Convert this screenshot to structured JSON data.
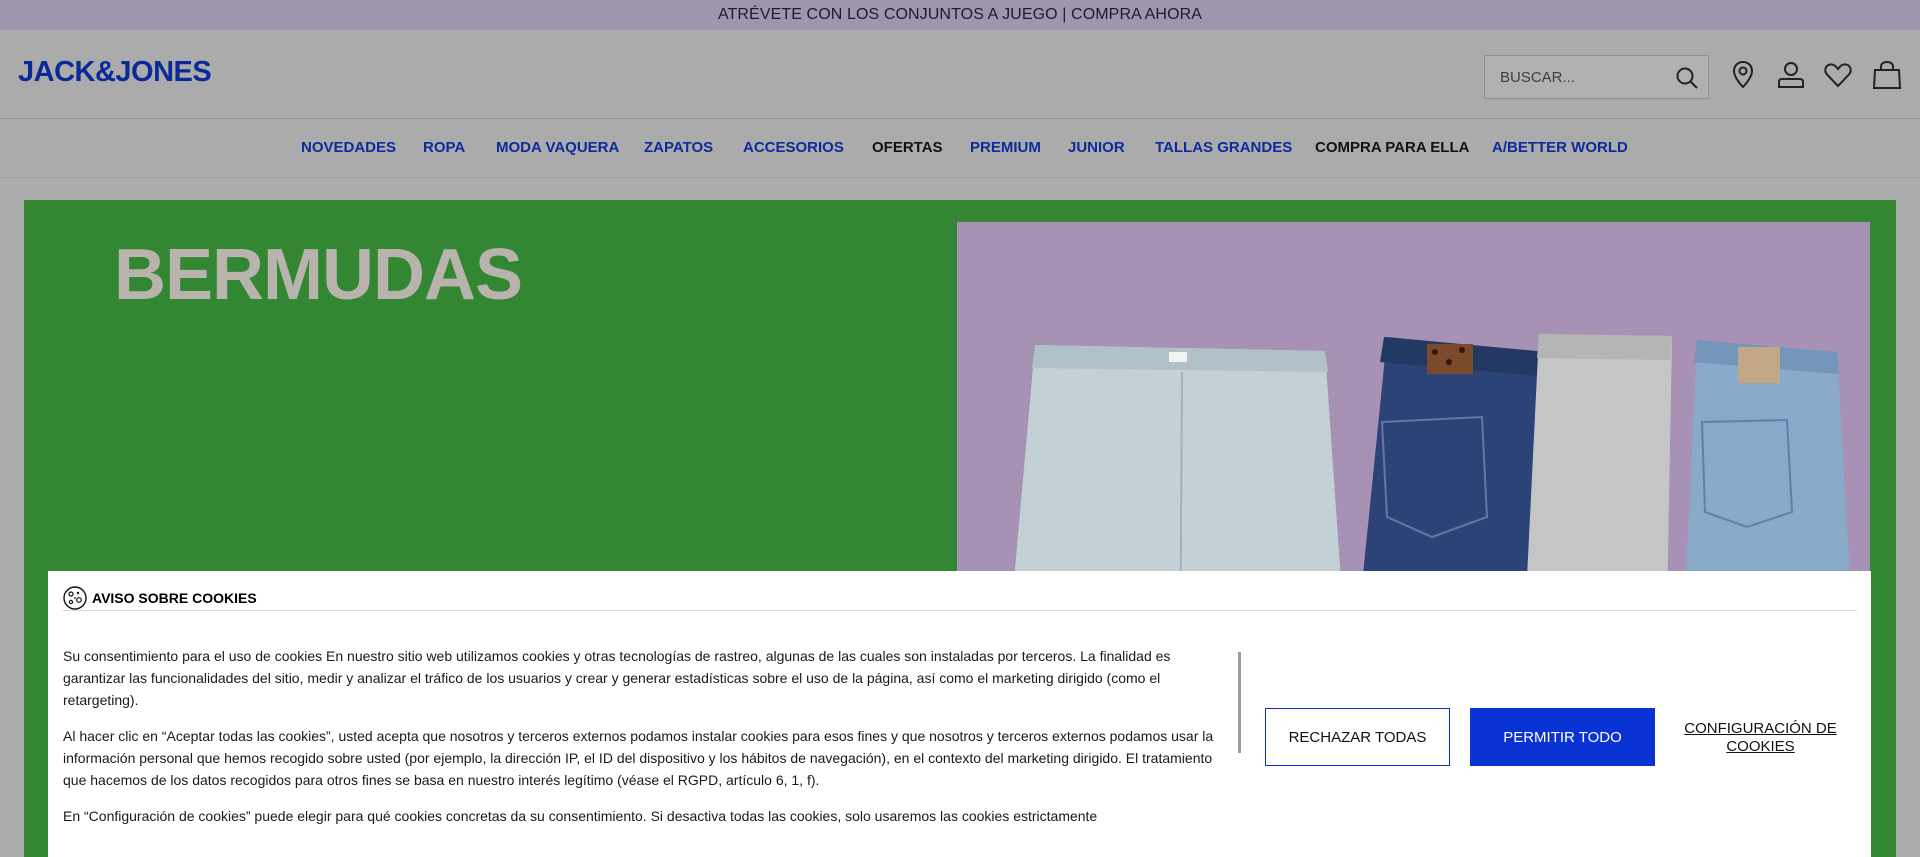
{
  "promo": {
    "text": "ATRÉVETE CON LOS CONJUNTOS A JUEGO | COMPRA AHORA"
  },
  "header": {
    "logo": "JACK&JONES",
    "search_placeholder": "BUSCAR...",
    "icons": [
      "store-locator-icon",
      "account-icon",
      "wishlist-icon",
      "bag-icon"
    ]
  },
  "nav": {
    "items": [
      {
        "label": "NOVEDADES",
        "style": "accent"
      },
      {
        "label": "ROPA",
        "style": "accent"
      },
      {
        "label": "MODA VAQUERA",
        "style": "accent"
      },
      {
        "label": "ZAPATOS",
        "style": "accent"
      },
      {
        "label": "ACCESORIOS",
        "style": "accent"
      },
      {
        "label": "OFERTAS",
        "style": "dark"
      },
      {
        "label": "PREMIUM",
        "style": "accent"
      },
      {
        "label": "JUNIOR",
        "style": "accent"
      },
      {
        "label": "TALLAS GRANDES",
        "style": "accent"
      },
      {
        "label": "COMPRA PARA ELLA",
        "style": "dark"
      },
      {
        "label": "A/BETTER WORLD",
        "style": "accent"
      }
    ]
  },
  "hero": {
    "title": "BERMUDAS"
  },
  "cookie": {
    "title": "AVISO SOBRE COOKIES",
    "paragraphs": [
      "Su consentimiento para el uso de cookies En nuestro sitio web utilizamos cookies y otras tecnologías de rastreo, algunas de las cuales son instaladas por terceros. La finalidad es garantizar las funcionalidades del sitio, medir y analizar el tráfico de los usuarios y crear y generar estadísticas sobre el uso de la página, así como el marketing dirigido (como el retargeting).",
      "Al hacer clic en “Aceptar todas las cookies”, usted acepta que nosotros y terceros externos podamos instalar cookies para esos fines y que nosotros y terceros externos podamos usar la información personal que hemos recogido sobre usted (por ejemplo, la dirección IP, el ID del dispositivo y los hábitos de navegación), en el contexto del marketing dirigido. El tratamiento que hacemos de los datos recogidos para otros fines se basa en nuestro interés legítimo (véase el RGPD, artículo 6, 1, f).",
      "En “Configuración de cookies” puede elegir para qué cookies concretas da su consentimiento. Si desactiva todas las cookies, solo usaremos las cookies estrictamente"
    ],
    "reject_label": "RECHAZAR TODAS",
    "allow_label": "PERMITIR TODO",
    "config_label": "CONFIGURACIÓN DE COOKIES"
  },
  "colors": {
    "brand_blue": "#0b2a99",
    "allow_button": "#0a33d6",
    "hero_green": "#338632",
    "promo_bar": "#9f96ae"
  }
}
